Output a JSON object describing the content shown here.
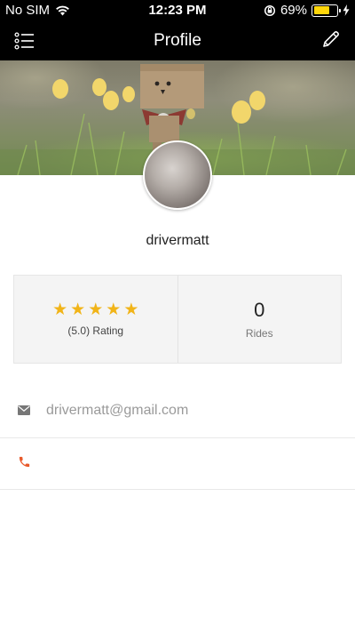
{
  "status_bar": {
    "carrier": "No SIM",
    "time": "12:23 PM",
    "battery_percent": "69%",
    "battery_level": 0.69,
    "icons": [
      "wifi-icon",
      "rotation-lock-icon",
      "battery-icon",
      "charging-bolt-icon"
    ]
  },
  "nav": {
    "title": "Profile",
    "left_icon": "list-menu-icon",
    "right_icon": "pencil-edit-icon"
  },
  "profile": {
    "username": "drivermatt",
    "rating": {
      "stars": 5,
      "label": "(5.0) Rating"
    },
    "rides": {
      "value": "0",
      "label": "Rides"
    },
    "email": "drivermatt@gmail.com",
    "phone": ""
  },
  "colors": {
    "header_bg": "#000000",
    "star": "#f1b418",
    "email_icon": "#777777",
    "phone_icon": "#e8592a",
    "battery": "#ffd60a"
  }
}
